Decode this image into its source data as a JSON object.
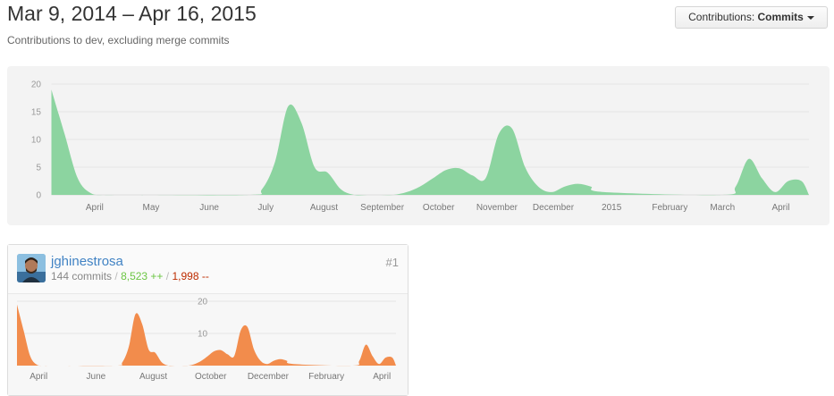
{
  "header": {
    "date_range": "Mar 9, 2014 – Apr 16, 2015",
    "subtitle": "Contributions to dev, excluding merge commits"
  },
  "contributions_dropdown": {
    "label": "Contributions:",
    "value": "Commits"
  },
  "contributor": {
    "username": "jghinestrosa",
    "commits": "144 commits",
    "separator": "/",
    "additions": "8,523 ++",
    "deletions": "1,998 --",
    "rank": "#1"
  },
  "chart_data": [
    {
      "type": "area",
      "title": "",
      "xlabel": "",
      "ylabel": "",
      "x_range": [
        "2014-03-09",
        "2015-04-16"
      ],
      "ylim": [
        0,
        20
      ],
      "y_ticks": [
        0,
        5,
        10,
        15,
        20
      ],
      "x_ticks": [
        {
          "date": "2014-04-01",
          "label": "April"
        },
        {
          "date": "2014-05-01",
          "label": "May"
        },
        {
          "date": "2014-06-01",
          "label": "June"
        },
        {
          "date": "2014-07-01",
          "label": "July"
        },
        {
          "date": "2014-08-01",
          "label": "August"
        },
        {
          "date": "2014-09-01",
          "label": "September"
        },
        {
          "date": "2014-10-01",
          "label": "October"
        },
        {
          "date": "2014-11-01",
          "label": "November"
        },
        {
          "date": "2014-12-01",
          "label": "December"
        },
        {
          "date": "2015-01-01",
          "label": "2015"
        },
        {
          "date": "2015-02-01",
          "label": "February"
        },
        {
          "date": "2015-03-01",
          "label": "March"
        },
        {
          "date": "2015-04-01",
          "label": "April"
        }
      ],
      "grid": true,
      "color": "#8cd4a0",
      "x": [
        "2014-03-09",
        "2014-03-16",
        "2014-03-23",
        "2014-03-30",
        "2014-04-06",
        "2014-04-13",
        "2014-04-20",
        "2014-06-22",
        "2014-06-29",
        "2014-07-06",
        "2014-07-13",
        "2014-07-20",
        "2014-07-27",
        "2014-08-03",
        "2014-08-10",
        "2014-08-17",
        "2014-08-24",
        "2014-08-31",
        "2014-09-07",
        "2014-09-14",
        "2014-09-21",
        "2014-09-28",
        "2014-10-05",
        "2014-10-12",
        "2014-10-19",
        "2014-10-26",
        "2014-11-02",
        "2014-11-09",
        "2014-11-16",
        "2014-11-23",
        "2014-11-30",
        "2014-12-07",
        "2014-12-14",
        "2014-12-21",
        "2014-12-28",
        "2015-03-01",
        "2015-03-08",
        "2015-03-15",
        "2015-03-22",
        "2015-03-29",
        "2015-04-05",
        "2015-04-12",
        "2015-04-16"
      ],
      "values": [
        19,
        11,
        3,
        0.3,
        0,
        0,
        0,
        0,
        1,
        6,
        16,
        13,
        5,
        4,
        1,
        0,
        0,
        0,
        0,
        0.5,
        1.5,
        3,
        4.5,
        4.8,
        3.5,
        3,
        11,
        12,
        5,
        1.5,
        0.5,
        1.5,
        2,
        1.5,
        0.5,
        0,
        1.5,
        6.5,
        3,
        0.5,
        2.5,
        2.5,
        0
      ]
    },
    {
      "type": "area",
      "title": "",
      "xlabel": "",
      "ylabel": "",
      "x_range": [
        "2014-03-09",
        "2015-04-16"
      ],
      "ylim": [
        0,
        20
      ],
      "y_ticks": [
        10,
        20
      ],
      "x_ticks": [
        {
          "date": "2014-04-01",
          "label": "April"
        },
        {
          "date": "2014-06-01",
          "label": "June"
        },
        {
          "date": "2014-08-01",
          "label": "August"
        },
        {
          "date": "2014-10-01",
          "label": "October"
        },
        {
          "date": "2014-12-01",
          "label": "December"
        },
        {
          "date": "2015-02-01",
          "label": "February"
        },
        {
          "date": "2015-04-01",
          "label": "April"
        }
      ],
      "grid": true,
      "color": "#f28c4c",
      "series": [
        {
          "name": "jghinestrosa"
        }
      ]
    }
  ]
}
